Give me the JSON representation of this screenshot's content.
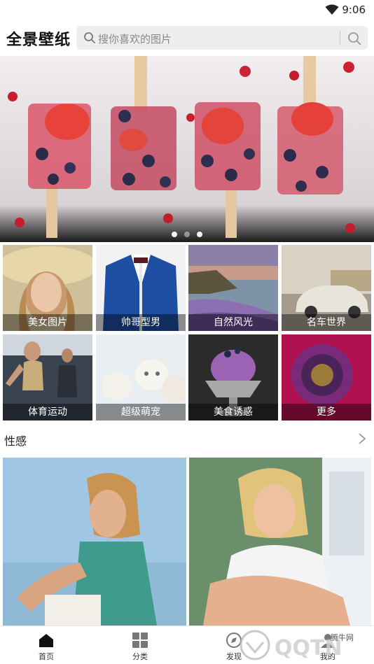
{
  "status_bar": {
    "time": "9:06",
    "wifi_icon": "wifi-icon"
  },
  "header": {
    "app_title": "全景壁纸",
    "search_placeholder": "搜你喜欢的图片",
    "search_icon": "search-icon"
  },
  "banner": {
    "dots": 3,
    "active_dot": 0
  },
  "categories": [
    {
      "label": "美女图片"
    },
    {
      "label": "帅哥型男"
    },
    {
      "label": "自然风光"
    },
    {
      "label": "名车世界"
    },
    {
      "label": "体育运动"
    },
    {
      "label": "超级萌宠"
    },
    {
      "label": "美食诱惑"
    },
    {
      "label": "更多"
    }
  ],
  "section": {
    "title": "性感",
    "more_icon": "chevron-right-icon"
  },
  "tabbar": {
    "tabs": [
      {
        "label": "首页",
        "icon": "home-icon"
      },
      {
        "label": "分类",
        "icon": "grid-icon"
      },
      {
        "label": "发现",
        "icon": "discover-icon"
      },
      {
        "label": "我的",
        "icon": "profile-icon"
      }
    ]
  },
  "watermark": {
    "text": "QQTN",
    "sub": "腾牛网"
  }
}
